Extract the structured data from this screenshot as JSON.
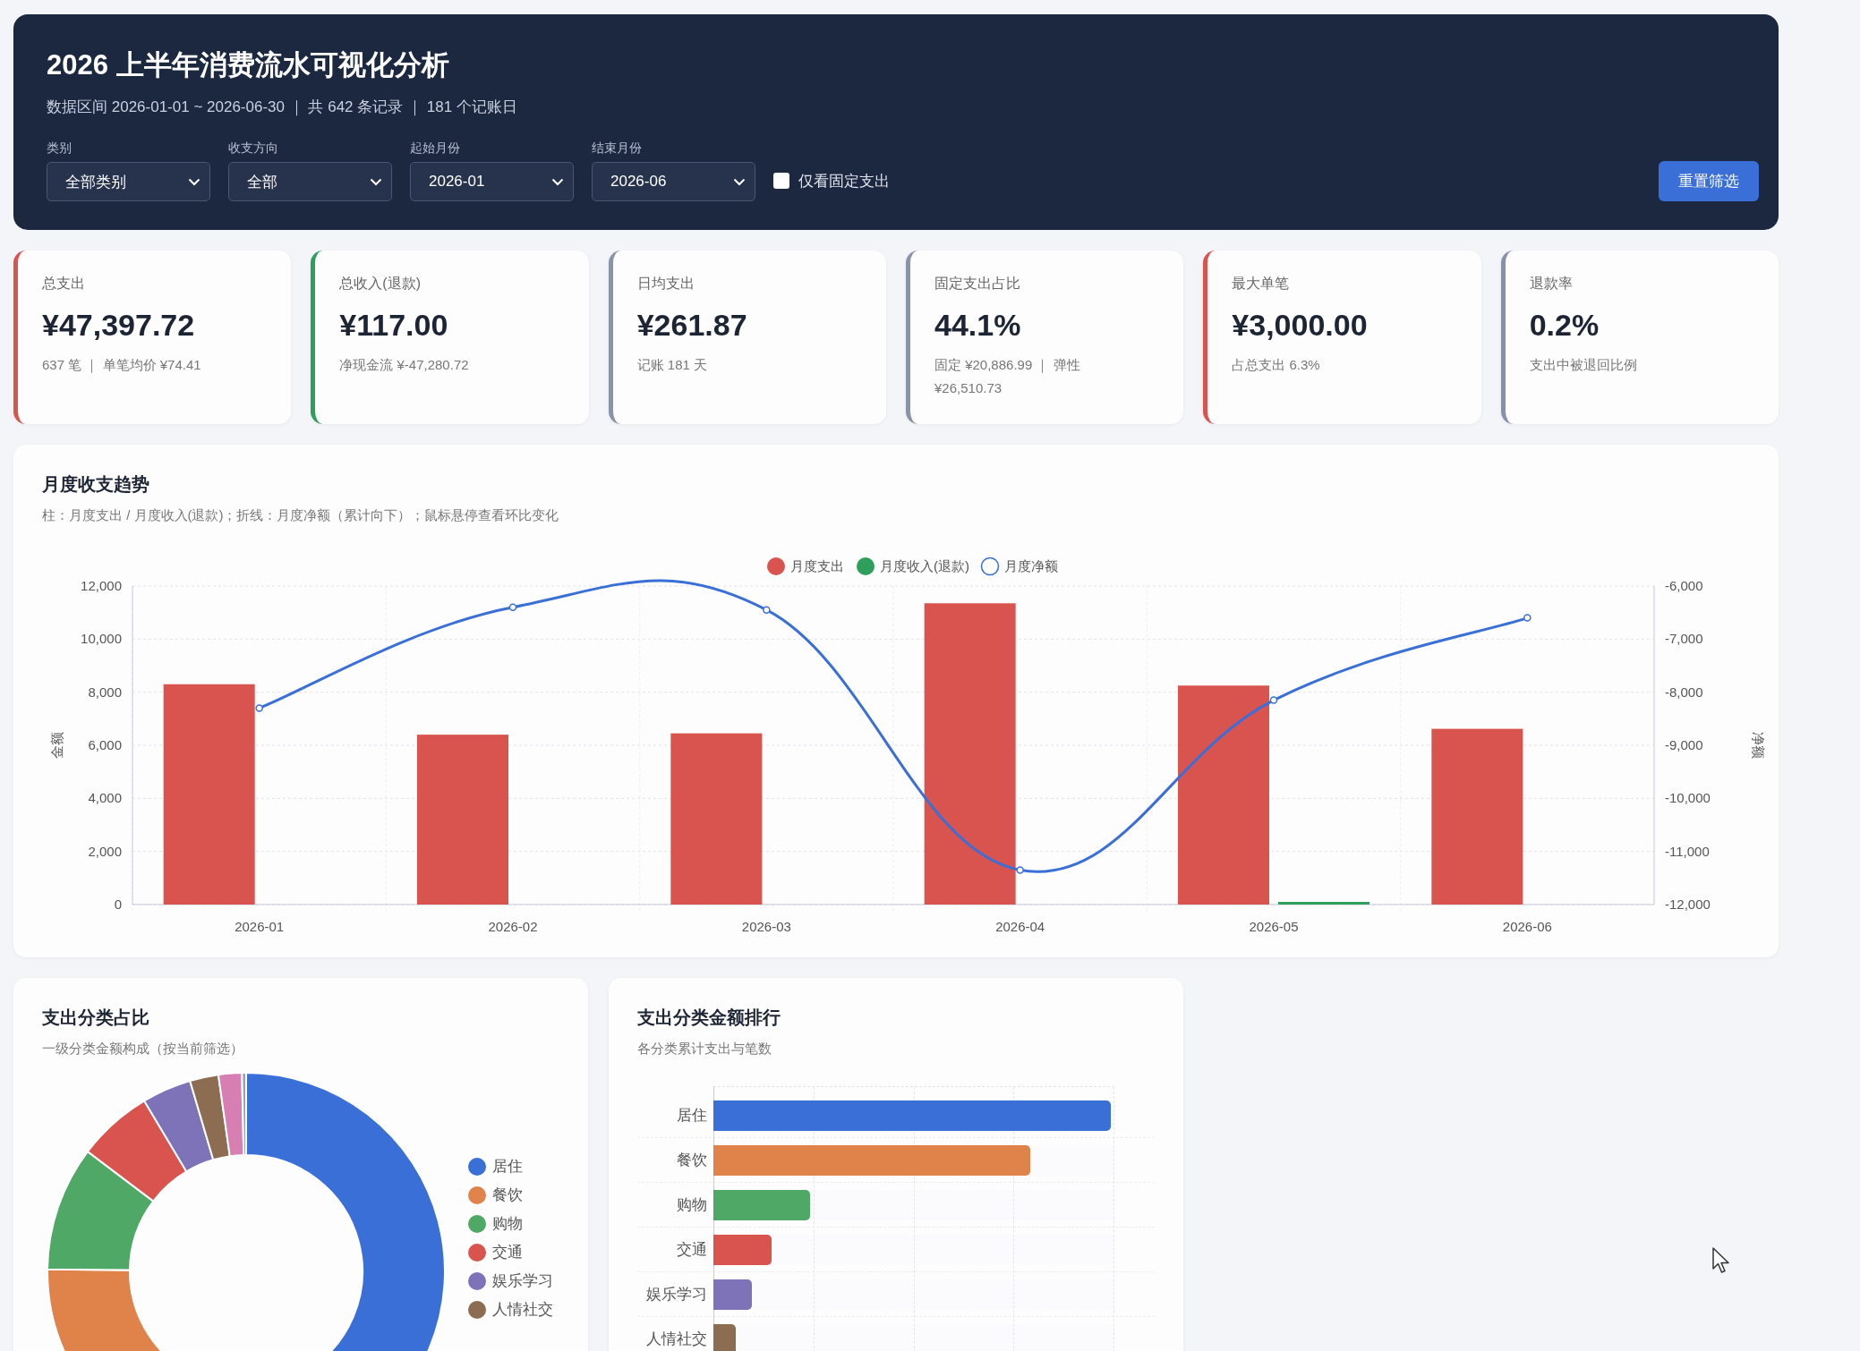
{
  "header": {
    "title": "2026 上半年消费流水可视化分析",
    "summary": "数据区间 2026-01-01 ~ 2026-06-30 ｜ 共 642 条记录 ｜ 181 个记账日",
    "filters": [
      {
        "label": "类别",
        "value": "全部类别"
      },
      {
        "label": "收支方向",
        "value": "全部"
      },
      {
        "label": "起始月份",
        "value": "2026-01"
      },
      {
        "label": "结束月份",
        "value": "2026-06"
      }
    ],
    "fixed_only": {
      "label": "仅看固定支出",
      "checked": false
    },
    "reset_button": "重置筛选"
  },
  "kpis": [
    {
      "label": "总支出",
      "value": "¥47,397.72",
      "note": "637 笔 ｜ 单笔均价 ¥74.41",
      "color": "#d9534f"
    },
    {
      "label": "总收入(退款)",
      "value": "¥117.00",
      "note": "净现金流 ¥-47,280.72",
      "color": "#2e9e5b"
    },
    {
      "label": "日均支出",
      "value": "¥261.87",
      "note": "记账 181 天",
      "color": "#8a93a8"
    },
    {
      "label": "固定支出占比",
      "value": "44.1%",
      "note": "固定 ¥20,886.99 ｜ 弹性 ¥26,510.73",
      "color": "#8a93a8"
    },
    {
      "label": "最大单笔",
      "value": "¥3,000.00",
      "note": "占总支出 6.3%",
      "color": "#d9534f"
    },
    {
      "label": "退款率",
      "value": "0.2%",
      "note": "支出中被退回比例",
      "color": "#8b8fae"
    }
  ],
  "trend": {
    "title": "月度收支趋势",
    "subtitle": "柱：月度支出 / 月度收入(退款)；折线：月度净额（累计向下）；鼠标悬停查看环比变化",
    "chart_data": {
      "type": "bar",
      "ylabel": "金额",
      "y2label": "净额",
      "categories": [
        "2026-01",
        "2026-02",
        "2026-03",
        "2026-04",
        "2026-05",
        "2026-06"
      ],
      "series": [
        {
          "name": "月度支出",
          "type": "bar",
          "color": "#d9534f",
          "values": [
            8300,
            6400,
            6450,
            11350,
            8250,
            6620
          ]
        },
        {
          "name": "月度收入(退款)",
          "type": "bar",
          "color": "#2e9e5b",
          "values": [
            0,
            0,
            0,
            0,
            100,
            0
          ]
        },
        {
          "name": "月度净额",
          "type": "line",
          "axis": "y2",
          "marker": "circle",
          "color": "#3a6fd8",
          "values": [
            -8300,
            -6400,
            -6450,
            -11350,
            -8150,
            -6600
          ]
        }
      ],
      "grid": true,
      "legend": "top",
      "ylim": [
        0,
        12000
      ],
      "yticks": [
        {
          "value": 0,
          "label": "0"
        },
        {
          "value": 2000,
          "label": "2,000"
        },
        {
          "value": 4000,
          "label": "4,000"
        },
        {
          "value": 6000,
          "label": "6,000"
        },
        {
          "value": 8000,
          "label": "8,000"
        },
        {
          "value": 10000,
          "label": "10,000"
        },
        {
          "value": 12000,
          "label": "12,000"
        }
      ],
      "y2lim": [
        -12000,
        -6000
      ],
      "y2ticks": [
        {
          "value": -12000,
          "label": "-12,000"
        },
        {
          "value": -11000,
          "label": "-11,000"
        },
        {
          "value": -10000,
          "label": "-10,000"
        },
        {
          "value": -9000,
          "label": "-9,000"
        },
        {
          "value": -8000,
          "label": "-8,000"
        },
        {
          "value": -7000,
          "label": "-7,000"
        },
        {
          "value": -6000,
          "label": "-6,000"
        }
      ]
    }
  },
  "category_share": {
    "title": "支出分类占比",
    "subtitle": "一级分类金额构成（按当前筛选）",
    "legend": [
      {
        "label": "居住",
        "color": "#3a6fd8"
      },
      {
        "label": "餐饮",
        "color": "#e0834a"
      },
      {
        "label": "购物",
        "color": "#4fa865"
      },
      {
        "label": "交通",
        "color": "#d9534f"
      },
      {
        "label": "娱乐学习",
        "color": "#7e72b8"
      },
      {
        "label": "人情社交",
        "color": "#8c6d52"
      }
    ]
  },
  "category_rank": {
    "title": "支出分类金额排行",
    "subtitle": "各分类累计支出与笔数",
    "rows": [
      {
        "label": "居住",
        "level": 0.99,
        "color": "#3a6fd8"
      },
      {
        "label": "餐饮",
        "level": 0.79,
        "color": "#e0834a"
      },
      {
        "label": "购物",
        "level": 0.24,
        "color": "#4fa865"
      },
      {
        "label": "交通",
        "level": 0.145,
        "color": "#d9534f"
      },
      {
        "label": "娱乐学习",
        "level": 0.095,
        "color": "#7e72b8"
      },
      {
        "label": "人情社交",
        "level": 0.055,
        "color": "#8c6d52"
      }
    ]
  }
}
